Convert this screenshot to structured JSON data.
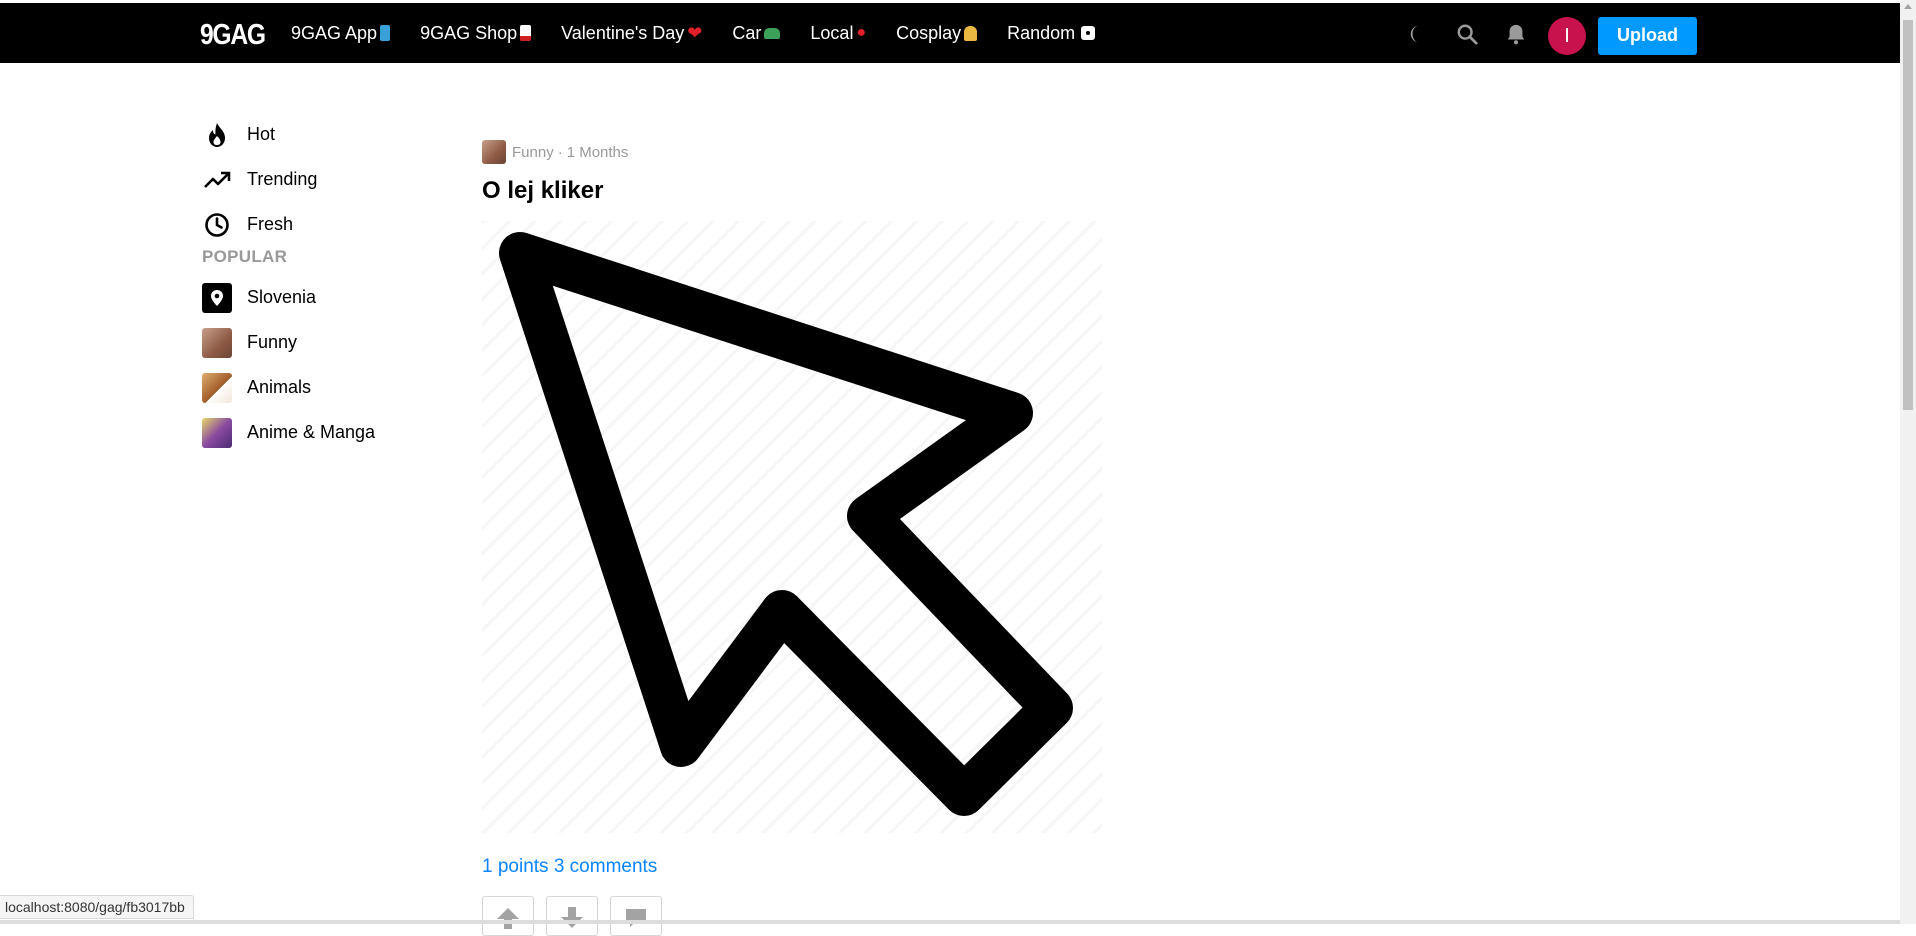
{
  "topbar": {
    "logo": "9GAG",
    "nav": [
      {
        "label": "9GAG App",
        "emoji": "mobile-phone-icon"
      },
      {
        "label": "9GAG Shop",
        "emoji": "gift-icon"
      },
      {
        "label": "Valentine's Day",
        "emoji": "heart-icon"
      },
      {
        "label": "Car",
        "emoji": "car-icon"
      },
      {
        "label": "Local",
        "emoji": "pin-icon"
      },
      {
        "label": "Cosplay",
        "emoji": "superhero-icon"
      },
      {
        "label": "Random",
        "emoji": "dice-icon"
      }
    ],
    "avatar_letter": "I",
    "upload_label": "Upload",
    "icons": [
      "moon-icon",
      "search-icon",
      "bell-icon"
    ]
  },
  "sidebar": {
    "items": [
      {
        "label": "Hot",
        "icon": "fire-icon"
      },
      {
        "label": "Trending",
        "icon": "trending-icon"
      },
      {
        "label": "Fresh",
        "icon": "clock-icon"
      }
    ],
    "section_title": "POPULAR",
    "popular": [
      {
        "label": "Slovenia",
        "icon": "location-pin-icon"
      },
      {
        "label": "Funny",
        "icon": "funny-thumbnail"
      },
      {
        "label": "Animals",
        "icon": "animals-thumbnail"
      },
      {
        "label": "Anime & Manga",
        "icon": "anime-thumbnail"
      }
    ]
  },
  "post": {
    "section": "Funny",
    "age": "1 Months",
    "meta_separator": "·",
    "title": "O lej kliker",
    "stats": "1 points 3 comments",
    "image_subject": "cursor-arrow-illustration"
  },
  "statusbar": {
    "url": "localhost:8080/gag/fb3017bb"
  },
  "colors": {
    "topbar_bg": "#000000",
    "upload": "#0099ff",
    "avatar": "#c8124e",
    "link": "#0a84ff",
    "section_head": "#999999"
  }
}
